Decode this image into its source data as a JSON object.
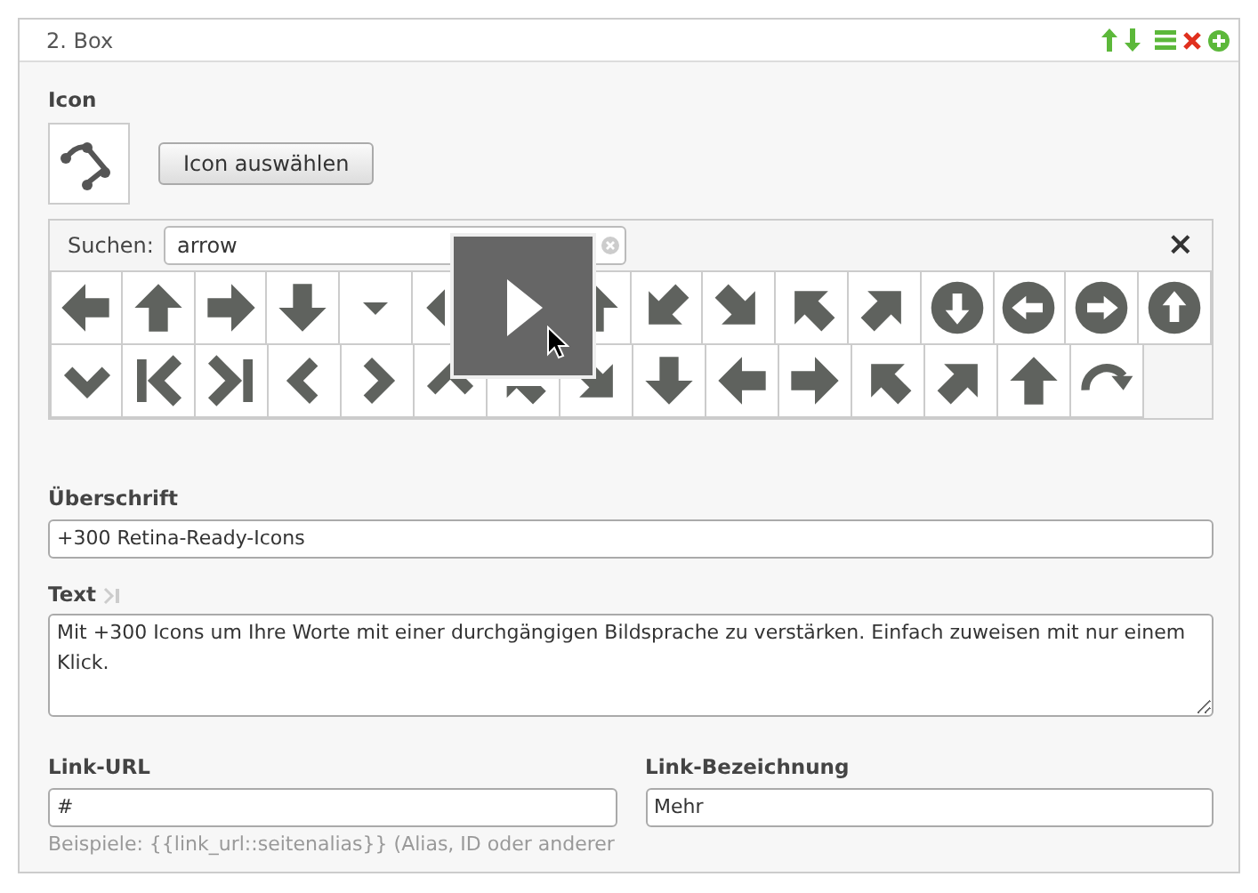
{
  "panel": {
    "title": "2. Box"
  },
  "icon_section": {
    "label": "Icon",
    "button": "Icon auswählen"
  },
  "icon_picker": {
    "search_label": "Suchen:",
    "search_value": "arrow",
    "close": "×"
  },
  "fields": [
    {
      "label": "Überschrift",
      "value": "+300 Retina-Ready-Icons",
      "kind": "input"
    },
    {
      "label": "Text",
      "value": "Mit +300 Icons um Ihre Worte mit einer durchgängigen Bildsprache zu verstärken. Einfach zuweisen mit nur einem Klick.",
      "kind": "textarea"
    }
  ],
  "link_fields": [
    {
      "label": "Link-URL",
      "value": "#",
      "help": "Beispiele: {{link_url::seitenalias}} (Alias, ID oder anderer"
    },
    {
      "label": "Link-Bezeichnung",
      "value": "Mehr"
    }
  ]
}
